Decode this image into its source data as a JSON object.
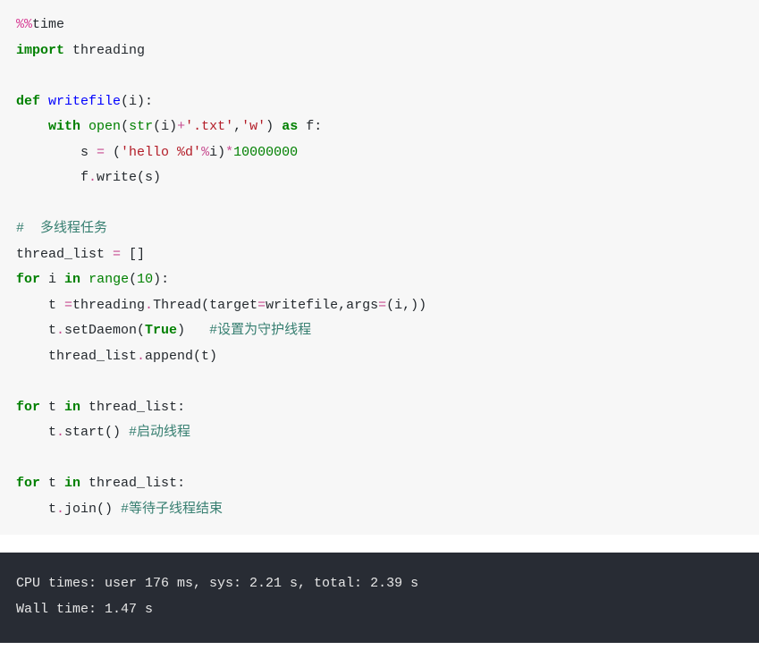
{
  "code": {
    "l1_a": "%%",
    "l1_b": "time",
    "l2_a": "import",
    "l2_b": " threading",
    "l3": "",
    "l4_a": "def",
    "l4_b": " ",
    "l4_c": "writefile",
    "l4_d": "(i):",
    "l5_a": "    ",
    "l5_b": "with",
    "l5_c": " ",
    "l5_d": "open",
    "l5_e": "(",
    "l5_f": "str",
    "l5_g": "(i)",
    "l5_h": "+",
    "l5_i": "'.txt'",
    "l5_j": ",",
    "l5_k": "'w'",
    "l5_l": ") ",
    "l5_m": "as",
    "l5_n": " f:",
    "l6_a": "        s ",
    "l6_b": "=",
    "l6_c": " (",
    "l6_d": "'hello %d'",
    "l6_e": "%",
    "l6_f": "i)",
    "l6_g": "*",
    "l6_h": "10000000",
    "l7_a": "        f",
    "l7_b": ".",
    "l7_c": "write(s)",
    "l8": "",
    "l9": "#  多线程任务",
    "l10_a": "thread_list ",
    "l10_b": "=",
    "l10_c": " []",
    "l11_a": "for",
    "l11_b": " i ",
    "l11_c": "in",
    "l11_d": " ",
    "l11_e": "range",
    "l11_f": "(",
    "l11_g": "10",
    "l11_h": "):",
    "l12_a": "    t ",
    "l12_b": "=",
    "l12_c": "threading",
    "l12_d": ".",
    "l12_e": "Thread(target",
    "l12_f": "=",
    "l12_g": "writefile,args",
    "l12_h": "=",
    "l12_i": "(i,))",
    "l13_a": "    t",
    "l13_b": ".",
    "l13_c": "setDaemon(",
    "l13_d": "True",
    "l13_e": ")   ",
    "l13_f": "#设置为守护线程",
    "l14_a": "    thread_list",
    "l14_b": ".",
    "l14_c": "append(t)",
    "l15": "",
    "l16_a": "for",
    "l16_b": " t ",
    "l16_c": "in",
    "l16_d": " thread_list:",
    "l17_a": "    t",
    "l17_b": ".",
    "l17_c": "start() ",
    "l17_d": "#启动线程",
    "l18": "",
    "l19_a": "for",
    "l19_b": " t ",
    "l19_c": "in",
    "l19_d": " thread_list:",
    "l20_a": "    t",
    "l20_b": ".",
    "l20_c": "join() ",
    "l20_d": "#等待子线程结束"
  },
  "output": {
    "line1": "CPU times: user 176 ms, sys: 2.21 s, total: 2.39 s",
    "line2": "Wall time: 1.47 s"
  }
}
